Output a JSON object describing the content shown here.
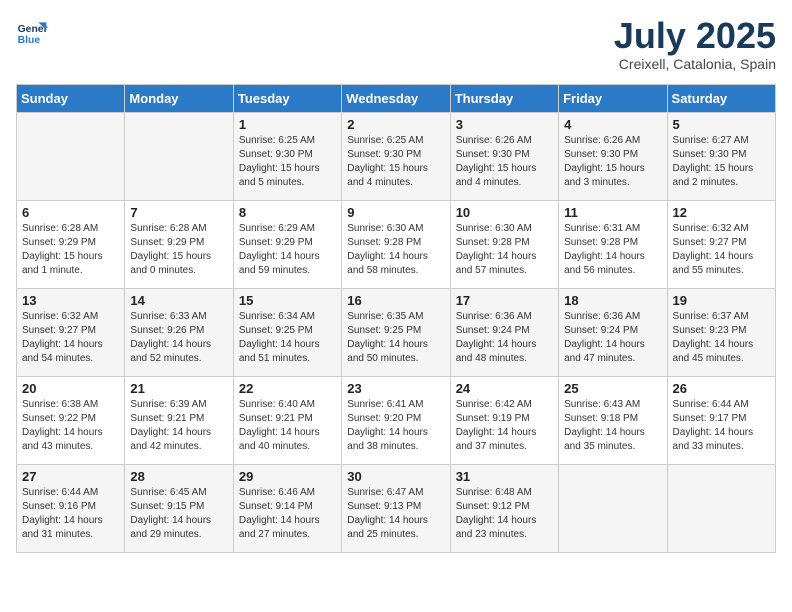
{
  "header": {
    "logo_line1": "General",
    "logo_line2": "Blue",
    "month": "July 2025",
    "location": "Creixell, Catalonia, Spain"
  },
  "weekdays": [
    "Sunday",
    "Monday",
    "Tuesday",
    "Wednesday",
    "Thursday",
    "Friday",
    "Saturday"
  ],
  "weeks": [
    [
      {
        "day": "",
        "text": ""
      },
      {
        "day": "",
        "text": ""
      },
      {
        "day": "1",
        "text": "Sunrise: 6:25 AM\nSunset: 9:30 PM\nDaylight: 15 hours\nand 5 minutes."
      },
      {
        "day": "2",
        "text": "Sunrise: 6:25 AM\nSunset: 9:30 PM\nDaylight: 15 hours\nand 4 minutes."
      },
      {
        "day": "3",
        "text": "Sunrise: 6:26 AM\nSunset: 9:30 PM\nDaylight: 15 hours\nand 4 minutes."
      },
      {
        "day": "4",
        "text": "Sunrise: 6:26 AM\nSunset: 9:30 PM\nDaylight: 15 hours\nand 3 minutes."
      },
      {
        "day": "5",
        "text": "Sunrise: 6:27 AM\nSunset: 9:30 PM\nDaylight: 15 hours\nand 2 minutes."
      }
    ],
    [
      {
        "day": "6",
        "text": "Sunrise: 6:28 AM\nSunset: 9:29 PM\nDaylight: 15 hours\nand 1 minute."
      },
      {
        "day": "7",
        "text": "Sunrise: 6:28 AM\nSunset: 9:29 PM\nDaylight: 15 hours\nand 0 minutes."
      },
      {
        "day": "8",
        "text": "Sunrise: 6:29 AM\nSunset: 9:29 PM\nDaylight: 14 hours\nand 59 minutes."
      },
      {
        "day": "9",
        "text": "Sunrise: 6:30 AM\nSunset: 9:28 PM\nDaylight: 14 hours\nand 58 minutes."
      },
      {
        "day": "10",
        "text": "Sunrise: 6:30 AM\nSunset: 9:28 PM\nDaylight: 14 hours\nand 57 minutes."
      },
      {
        "day": "11",
        "text": "Sunrise: 6:31 AM\nSunset: 9:28 PM\nDaylight: 14 hours\nand 56 minutes."
      },
      {
        "day": "12",
        "text": "Sunrise: 6:32 AM\nSunset: 9:27 PM\nDaylight: 14 hours\nand 55 minutes."
      }
    ],
    [
      {
        "day": "13",
        "text": "Sunrise: 6:32 AM\nSunset: 9:27 PM\nDaylight: 14 hours\nand 54 minutes."
      },
      {
        "day": "14",
        "text": "Sunrise: 6:33 AM\nSunset: 9:26 PM\nDaylight: 14 hours\nand 52 minutes."
      },
      {
        "day": "15",
        "text": "Sunrise: 6:34 AM\nSunset: 9:25 PM\nDaylight: 14 hours\nand 51 minutes."
      },
      {
        "day": "16",
        "text": "Sunrise: 6:35 AM\nSunset: 9:25 PM\nDaylight: 14 hours\nand 50 minutes."
      },
      {
        "day": "17",
        "text": "Sunrise: 6:36 AM\nSunset: 9:24 PM\nDaylight: 14 hours\nand 48 minutes."
      },
      {
        "day": "18",
        "text": "Sunrise: 6:36 AM\nSunset: 9:24 PM\nDaylight: 14 hours\nand 47 minutes."
      },
      {
        "day": "19",
        "text": "Sunrise: 6:37 AM\nSunset: 9:23 PM\nDaylight: 14 hours\nand 45 minutes."
      }
    ],
    [
      {
        "day": "20",
        "text": "Sunrise: 6:38 AM\nSunset: 9:22 PM\nDaylight: 14 hours\nand 43 minutes."
      },
      {
        "day": "21",
        "text": "Sunrise: 6:39 AM\nSunset: 9:21 PM\nDaylight: 14 hours\nand 42 minutes."
      },
      {
        "day": "22",
        "text": "Sunrise: 6:40 AM\nSunset: 9:21 PM\nDaylight: 14 hours\nand 40 minutes."
      },
      {
        "day": "23",
        "text": "Sunrise: 6:41 AM\nSunset: 9:20 PM\nDaylight: 14 hours\nand 38 minutes."
      },
      {
        "day": "24",
        "text": "Sunrise: 6:42 AM\nSunset: 9:19 PM\nDaylight: 14 hours\nand 37 minutes."
      },
      {
        "day": "25",
        "text": "Sunrise: 6:43 AM\nSunset: 9:18 PM\nDaylight: 14 hours\nand 35 minutes."
      },
      {
        "day": "26",
        "text": "Sunrise: 6:44 AM\nSunset: 9:17 PM\nDaylight: 14 hours\nand 33 minutes."
      }
    ],
    [
      {
        "day": "27",
        "text": "Sunrise: 6:44 AM\nSunset: 9:16 PM\nDaylight: 14 hours\nand 31 minutes."
      },
      {
        "day": "28",
        "text": "Sunrise: 6:45 AM\nSunset: 9:15 PM\nDaylight: 14 hours\nand 29 minutes."
      },
      {
        "day": "29",
        "text": "Sunrise: 6:46 AM\nSunset: 9:14 PM\nDaylight: 14 hours\nand 27 minutes."
      },
      {
        "day": "30",
        "text": "Sunrise: 6:47 AM\nSunset: 9:13 PM\nDaylight: 14 hours\nand 25 minutes."
      },
      {
        "day": "31",
        "text": "Sunrise: 6:48 AM\nSunset: 9:12 PM\nDaylight: 14 hours\nand 23 minutes."
      },
      {
        "day": "",
        "text": ""
      },
      {
        "day": "",
        "text": ""
      }
    ]
  ]
}
